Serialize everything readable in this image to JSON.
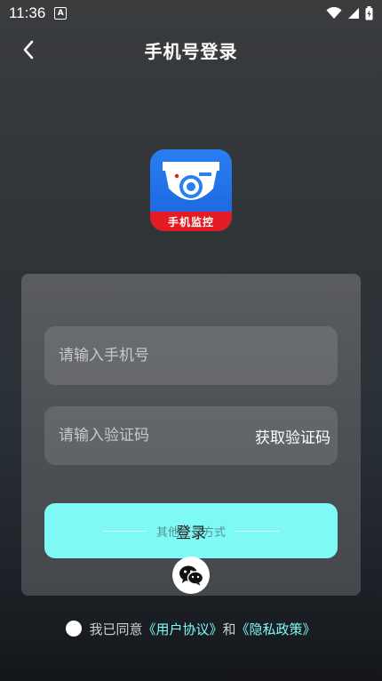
{
  "status_bar": {
    "time": "11:36",
    "notification_letter": "A"
  },
  "header": {
    "title": "手机号登录"
  },
  "logo": {
    "badge_text": "手机监控"
  },
  "form": {
    "phone_placeholder": "请输入手机号",
    "code_placeholder": "请输入验证码",
    "get_code_label": "获取验证码",
    "login_label": "登录",
    "other_methods_label": "其他登录方式"
  },
  "agreement": {
    "prefix": "我已同意",
    "user_agreement": "《用户协议》",
    "and": "和",
    "privacy_policy": "《隐私政策》"
  },
  "colors": {
    "accent": "#7ef9f5",
    "logo_blue": "#1f6fe8",
    "logo_red": "#e31b23"
  }
}
